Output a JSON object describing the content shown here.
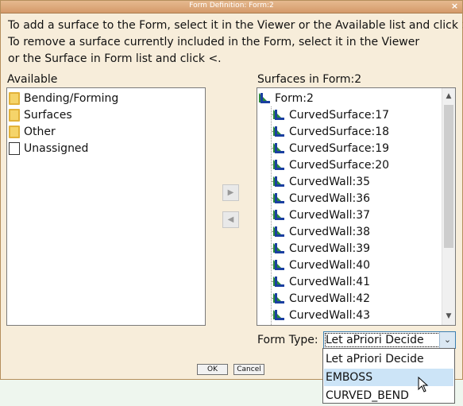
{
  "window": {
    "title": "Form Definition: Form:2",
    "close_glyph": "×"
  },
  "instructions": [
    "To add a surface to the Form, select it in the Viewer or the Available list and click >.",
    "To remove a surface currently included in the Form, select it in the Viewer",
    "or the Surface in Form list and click <."
  ],
  "available": {
    "label": "Available",
    "items": [
      {
        "label": "Bending/Forming",
        "icon": "folder-icon"
      },
      {
        "label": "Surfaces",
        "icon": "folder-icon"
      },
      {
        "label": "Other",
        "icon": "folder-icon"
      },
      {
        "label": "Unassigned",
        "icon": "document-icon"
      }
    ]
  },
  "surfaces": {
    "label": "Surfaces in Form:2",
    "root": "Form:2",
    "items": [
      "CurvedSurface:17",
      "CurvedSurface:18",
      "CurvedSurface:19",
      "CurvedSurface:20",
      "CurvedWall:35",
      "CurvedWall:36",
      "CurvedWall:37",
      "CurvedWall:38",
      "CurvedWall:39",
      "CurvedWall:40",
      "CurvedWall:41",
      "CurvedWall:42",
      "CurvedWall:43"
    ]
  },
  "buttons": {
    "add": "▶",
    "remove": "◀",
    "ok": "OK",
    "cancel": "Cancel"
  },
  "form_type": {
    "label": "Form Type:",
    "value": "Let aPriori Decide",
    "options": [
      "Let aPriori Decide",
      "EMBOSS",
      "CURVED_BEND"
    ],
    "highlighted_index": 1
  },
  "colors": {
    "dialog_bg": "#f7edda",
    "titlebar": "#d49a6a",
    "highlight": "#cce4f7"
  }
}
